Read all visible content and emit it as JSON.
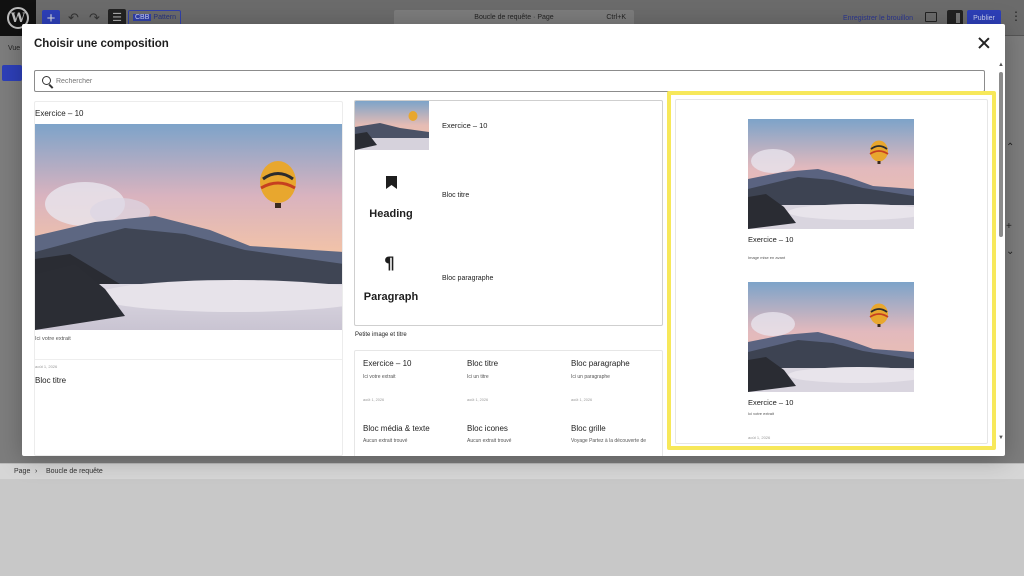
{
  "editor": {
    "top_search_title": "Boucle de requête · Page",
    "top_search_kbd": "Ctrl+K",
    "pattern_badge_prefix": "CBB",
    "pattern_badge": "Pattern",
    "save_draft": "Enregistrer le brouillon",
    "publish": "Publier",
    "left_tab": "Vue",
    "breadcrumb": [
      "Page",
      "Boucle de requête"
    ],
    "accent": "#3040a8"
  },
  "modal": {
    "title": "Choisir une composition",
    "search_placeholder": "Rechercher"
  },
  "col1": {
    "title": "Exercice – 10",
    "excerpt": "Ici votre extrait",
    "date": "août 1, 2026",
    "second_title": "Bloc titre"
  },
  "col2": {
    "top_card": {
      "row1_label": "Exercice – 10",
      "row2_big": "Heading",
      "row2_label": "Bloc titre",
      "row3_big": "Paragraph",
      "row3_label": "Bloc paragraphe"
    },
    "caption": "Petite image et titre",
    "grid": [
      {
        "title": "Exercice – 10",
        "sub": "Ici votre extrait",
        "date": "août 1, 2026"
      },
      {
        "title": "Bloc titre",
        "sub": "Ici un titre",
        "date": "août 1, 2026"
      },
      {
        "title": "Bloc paragraphe",
        "sub": "Ici un paragraphe",
        "date": "août 1, 2026"
      },
      {
        "title": "Bloc média & texte",
        "sub": "Aucun extrait trouvé",
        "date": ""
      },
      {
        "title": "Bloc icones",
        "sub": "Aucun extrait trouvé",
        "date": ""
      },
      {
        "title": "Bloc grille",
        "sub": "Voyage Partez à la découverte de",
        "date": ""
      }
    ]
  },
  "col3": {
    "item1_title": "Exercice – 10",
    "item1_sub": "Image mise en avant",
    "item2_title": "Exercice – 10",
    "item2_sub": "Ici votre extrait",
    "item2_date": "août 1, 2026",
    "highlight_color": "#f7e85a"
  }
}
